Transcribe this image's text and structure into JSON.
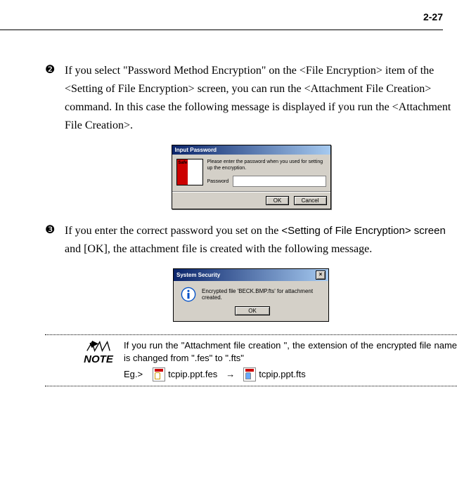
{
  "page_number": "2-27",
  "step2": {
    "bullet": "❷",
    "text": "If you select \"Password Method Encryption\" on the <File Encryption> item of the <Setting of File Encryption> screen, you can run the <Attachment File Creation> command. In this case the following message is displayed if you run the <Attachment File Creation>."
  },
  "dialog1": {
    "title": "Input Password",
    "message": "Please enter the password when you used for setting up the encryption.",
    "password_label": "Password",
    "ok": "OK",
    "cancel": "Cancel",
    "logo_text": "Safe"
  },
  "step3": {
    "bullet": "❸",
    "text_a": "If you enter the correct password you set on the ",
    "text_b": "<Setting of File Encryption> screen",
    "text_c": " and [OK], the attachment file is created with the following message."
  },
  "dialog2": {
    "title": "System Security",
    "message": "Encrypted file 'BECK.BMP.fts' for attachment created.",
    "ok": "OK"
  },
  "note": {
    "label": "NOTE",
    "text": "If you run the \"Attachment file creation \", the extension of the encrypted file name is changed from \".fes\" to \".fts\"",
    "eg_label": "Eg.>",
    "file1": "tcpip.ppt.fes",
    "arrow": "→",
    "file2": "tcpip.ppt.fts"
  }
}
